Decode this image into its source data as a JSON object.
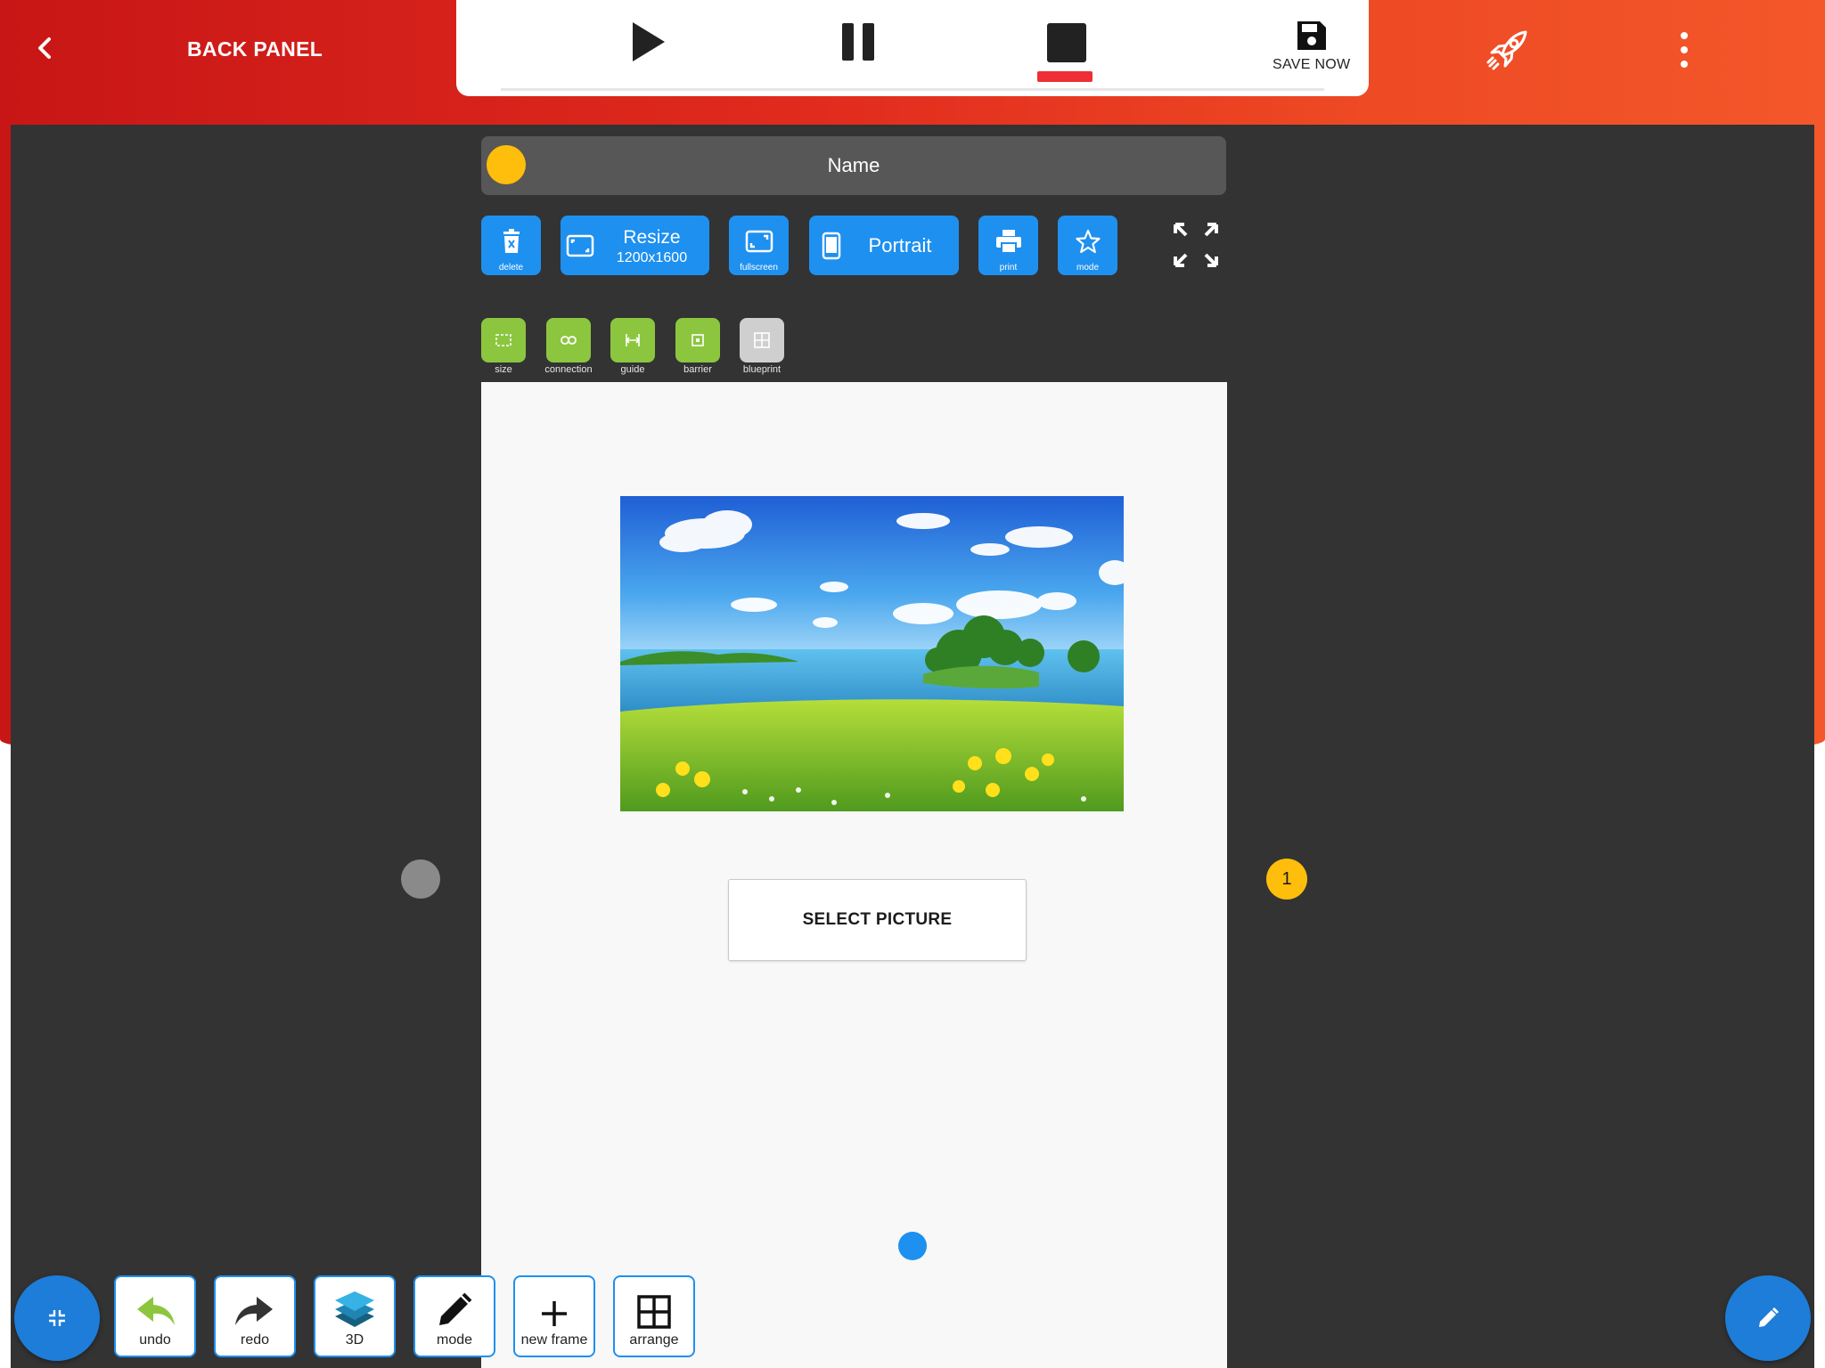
{
  "header": {
    "title": "BACK PANEL",
    "save_label": "SAVE NOW"
  },
  "name_bar": {
    "label": "Name"
  },
  "toolbar": {
    "delete_label": "delete",
    "resize_label": "Resize",
    "resize_size": "1200x1600",
    "fullscreen_label": "fullscreen",
    "orientation_label": "Portrait",
    "print_label": "print",
    "mode_label": "mode"
  },
  "tools": [
    {
      "label": "size"
    },
    {
      "label": "connection"
    },
    {
      "label": "guide"
    },
    {
      "label": "barrier"
    },
    {
      "label": "blueprint"
    }
  ],
  "canvas": {
    "select_picture_label": "SELECT PICTURE",
    "badge_number": "1"
  },
  "bottom_bar": [
    {
      "label": "undo"
    },
    {
      "label": "redo"
    },
    {
      "label": "3D"
    },
    {
      "label": "mode"
    },
    {
      "label": "new frame"
    },
    {
      "label": "arrange"
    }
  ],
  "colors": {
    "header_gradient_start": "#c81616",
    "header_gradient_end": "#f4572a",
    "primary_blue": "#1e90f0",
    "tool_green": "#8cc63f",
    "accent_yellow": "#ffbe0b",
    "stop_indicator": "#ef2e35",
    "workspace": "#333333"
  }
}
